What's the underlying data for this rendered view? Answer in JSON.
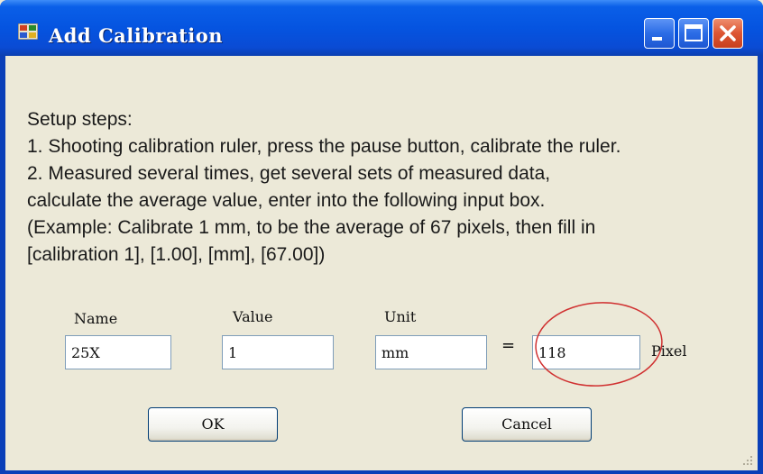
{
  "window": {
    "title": "Add Calibration",
    "icons": {
      "app": "app-icon",
      "minimize": "minimize-icon",
      "maximize": "maximize-icon",
      "close": "close-icon"
    }
  },
  "instructions": {
    "heading": "Setup steps:",
    "lines": [
      "1. Shooting calibration ruler, press the pause button, calibrate the ruler.",
      "2. Measured several times, get several sets of measured data,",
      "calculate the average value, enter into the following input box.",
      "(Example: Calibrate 1 mm, to be the average of 67 pixels, then fill in",
      "[calibration 1], [1.00], [mm], [67.00])"
    ]
  },
  "form": {
    "name_label": "Name",
    "name_value": "25X",
    "value_label": "Value",
    "value_value": "1",
    "unit_label": "Unit",
    "unit_value": "mm",
    "equals": "=",
    "pixel_value": "118",
    "pixel_label": "Pixel"
  },
  "buttons": {
    "ok": "OK",
    "cancel": "Cancel"
  },
  "colors": {
    "titlebar": "#0554E0",
    "client": "#ECE9D8",
    "highlight": "#D03030"
  }
}
